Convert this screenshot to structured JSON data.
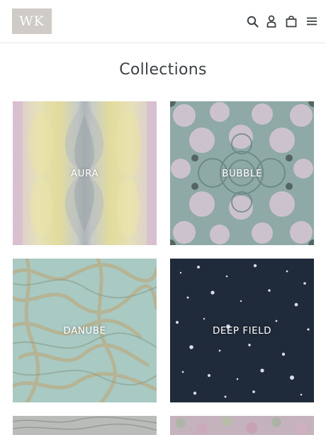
{
  "header": {
    "logo_text": "WK",
    "icons": [
      "search-icon",
      "account-icon",
      "cart-icon",
      "menu-icon"
    ]
  },
  "page": {
    "title": "Collections"
  },
  "collections": [
    {
      "label": "AURA"
    },
    {
      "label": "BUBBLE"
    },
    {
      "label": "DANUBE"
    },
    {
      "label": "DEEP FIELD"
    },
    {
      "label": ""
    },
    {
      "label": ""
    }
  ],
  "colors": {
    "logo_bg": "#cfcbc6",
    "text": "#3d4246",
    "deep_field_bg": "#1f2a3a"
  }
}
